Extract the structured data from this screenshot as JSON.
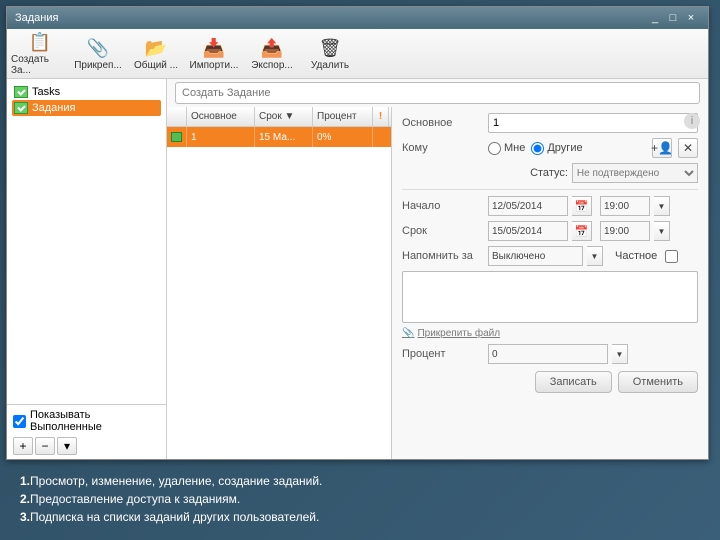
{
  "window": {
    "title": "Задания"
  },
  "toolbar": {
    "create": "Создать За...",
    "attach": "Прикреп...",
    "share": "Общий ...",
    "import": "Импорти...",
    "export": "Экспор...",
    "delete": "Удалить"
  },
  "sidebar": {
    "items": [
      {
        "label": "Tasks"
      },
      {
        "label": "Задания"
      }
    ],
    "show_done": "Показывать Выполненные"
  },
  "createbar": {
    "placeholder": "Создать Задание"
  },
  "list": {
    "cols": {
      "main": "Основное",
      "due": "Срок ▼",
      "pct": "Процент",
      "flag": "!"
    },
    "rows": [
      {
        "main": "1",
        "due": "15 Ма...",
        "pct": "0%"
      }
    ]
  },
  "detail": {
    "labels": {
      "main": "Основное",
      "to": "Кому",
      "status": "Статус:",
      "start": "Начало",
      "due": "Срок",
      "remind": "Напомнить за",
      "private": "Частное",
      "attach": "Прикрепить файл",
      "pct": "Процент"
    },
    "main_value": "1",
    "to": {
      "me": "Мне",
      "others": "Другие",
      "selected": "others"
    },
    "status_value": "Не подтверждено",
    "start": {
      "date": "12/05/2014",
      "time": "19:00"
    },
    "due": {
      "date": "15/05/2014",
      "time": "19:00"
    },
    "remind_value": "Выключено",
    "pct_value": "0",
    "buttons": {
      "save": "Записать",
      "cancel": "Отменить"
    }
  },
  "captions": {
    "l1": "Просмотр, изменение, удаление, создание заданий.",
    "l2": "Предоставление доступа к заданиям.",
    "l3": "Подписка на списки заданий других пользователей."
  }
}
